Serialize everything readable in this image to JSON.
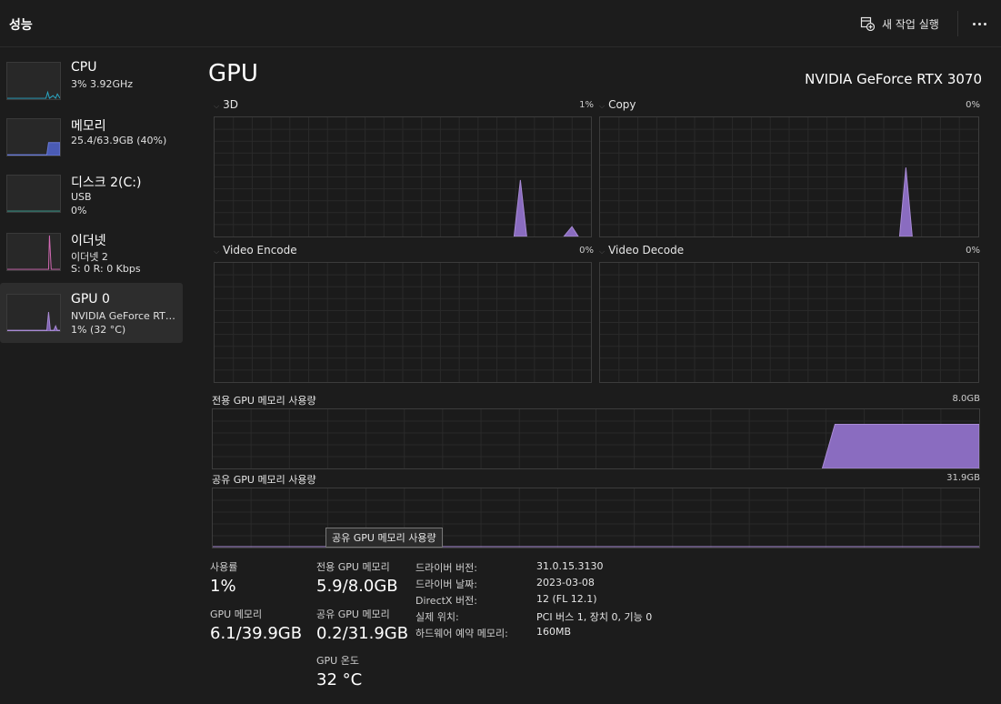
{
  "header": {
    "title": "성능",
    "run_task_label": "새 작업 실행"
  },
  "sidebar": {
    "items": [
      {
        "name": "CPU",
        "sub1": "3% 3.92GHz",
        "sub2": ""
      },
      {
        "name": "메모리",
        "sub1": "25.4/63.9GB (40%)",
        "sub2": ""
      },
      {
        "name": "디스크 2(C:)",
        "sub1": "USB",
        "sub2": "0%"
      },
      {
        "name": "이더넷",
        "sub1": "이더넷 2",
        "sub2": "S: 0 R: 0 Kbps"
      },
      {
        "name": "GPU 0",
        "sub1": "NVIDIA GeForce RTX 3070",
        "sub2": "1% (32 °C)"
      }
    ],
    "colors": {
      "cpu": "#2aa9c6",
      "memory": "#6a7bd6",
      "disk": "#3ea89a",
      "ethernet": "#d46ab5",
      "gpu": "#a98bd6"
    }
  },
  "main": {
    "title": "GPU",
    "device": "NVIDIA GeForce RTX 3070",
    "accent": "#a98bd6",
    "engines": [
      {
        "label": "3D",
        "pct": "1%"
      },
      {
        "label": "Copy",
        "pct": "0%"
      },
      {
        "label": "Video Encode",
        "pct": "0%"
      },
      {
        "label": "Video Decode",
        "pct": "0%"
      }
    ],
    "dedicated_mem": {
      "label": "전용 GPU 메모리 사용량",
      "max": "8.0GB"
    },
    "shared_mem": {
      "label": "공유 GPU 메모리 사용량",
      "max": "31.9GB"
    },
    "tooltip": "공유 GPU 메모리 사용량"
  },
  "stats": {
    "usage_label": "사용률",
    "usage_value": "1%",
    "gpu_mem_label": "GPU 메모리",
    "gpu_mem_value": "6.1/39.9GB",
    "dedicated_label": "전용 GPU 메모리",
    "dedicated_value": "5.9/8.0GB",
    "shared_label": "공유 GPU 메모리",
    "shared_value": "0.2/31.9GB",
    "temp_label": "GPU 온도",
    "temp_value": "32 °C"
  },
  "info": [
    {
      "key": "드라이버 버전:",
      "value": "31.0.15.3130"
    },
    {
      "key": "드라이버 날짜:",
      "value": "2023-03-08"
    },
    {
      "key": "DirectX 버전:",
      "value": "12 (FL 12.1)"
    },
    {
      "key": "실제 위치:",
      "value": "PCI 버스 1, 장치 0, 기능 0"
    },
    {
      "key": "하드웨어 예약 메모리:",
      "value": "160MB"
    }
  ]
}
